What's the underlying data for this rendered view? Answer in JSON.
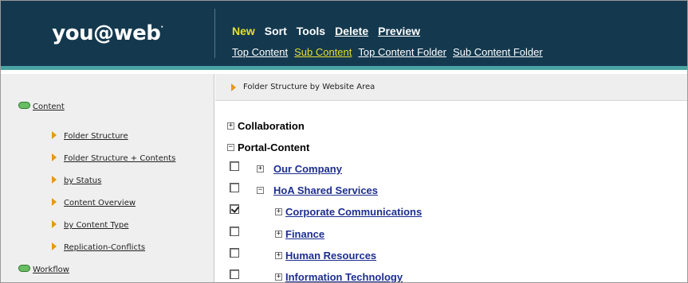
{
  "logo": {
    "text": "you@web",
    "mark": "·"
  },
  "toolbar": {
    "new": "New",
    "sort": "Sort",
    "tools": "Tools",
    "delete": "Delete",
    "preview": "Preview"
  },
  "subnav": {
    "top_content": "Top Content",
    "sub_content": "Sub Content",
    "top_content_folder": "Top Content Folder",
    "sub_content_folder": "Sub Content Folder"
  },
  "sidebar": {
    "content": "Content",
    "items": [
      "Folder Structure",
      "Folder Structure + Contents",
      "by Status",
      "Content Overview",
      "by Content Type",
      "Replication-Conflicts"
    ],
    "workflow": "Workflow"
  },
  "breadcrumb": "Folder Structure by Website Area",
  "tree": {
    "collaboration": "Collaboration",
    "portal_content": "Portal-Content",
    "our_company": "Our Company",
    "hoa_shared": "HoA Shared Services",
    "corporate_comms": "Corporate Communications",
    "finance": "Finance",
    "human_resources": "Human Resources",
    "information_technology": "Information Technology"
  },
  "colors": {
    "header_bg": "#14394f",
    "accent_line": "#49a3a3",
    "active_yellow": "#e8df2a",
    "link_blue": "#1d2e8f",
    "arrow_orange": "#e49a12"
  }
}
